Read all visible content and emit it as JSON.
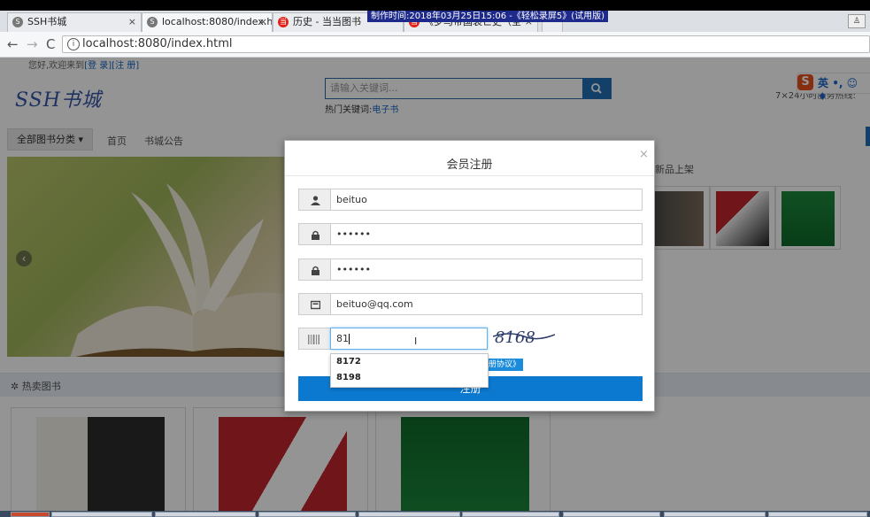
{
  "browser": {
    "tabs": [
      {
        "label": "SSH书城"
      },
      {
        "label": "localhost:8080/index.ht"
      },
      {
        "label": "历史 - 当当图书"
      },
      {
        "label": "《罗马帝国衰亡史（全"
      }
    ],
    "url": "localhost:8080/index.html",
    "record_banner": "制作时间:2018年03月25日15:06 -《轻松录屏5》(试用版)"
  },
  "page": {
    "welcome": {
      "text": "您好,欢迎来到",
      "login": "[登 录]",
      "register": "[注 册]"
    },
    "logo": "SSH书城",
    "search": {
      "placeholder": "请输入关键词...",
      "hot_label": "热门关键词:",
      "hot_link": "电子书"
    },
    "hotline": "7×24小时服务热线:",
    "ime": {
      "mode": "英"
    },
    "category_button": "全部图书分类",
    "nav": [
      "首页",
      "书城公告"
    ],
    "new_books_title": "新品上架",
    "hot_books_title": "热卖图书"
  },
  "modal": {
    "title": "会员注册",
    "close": "×",
    "username": "beituo",
    "password": "••••••",
    "confirm_password": "••••••",
    "email": "beituo@qq.com",
    "captcha_value": "81",
    "captcha_image_text": "8168",
    "autocomplete": [
      "8172",
      "8198"
    ],
    "agreement": "注册协议》",
    "submit": "注册"
  }
}
